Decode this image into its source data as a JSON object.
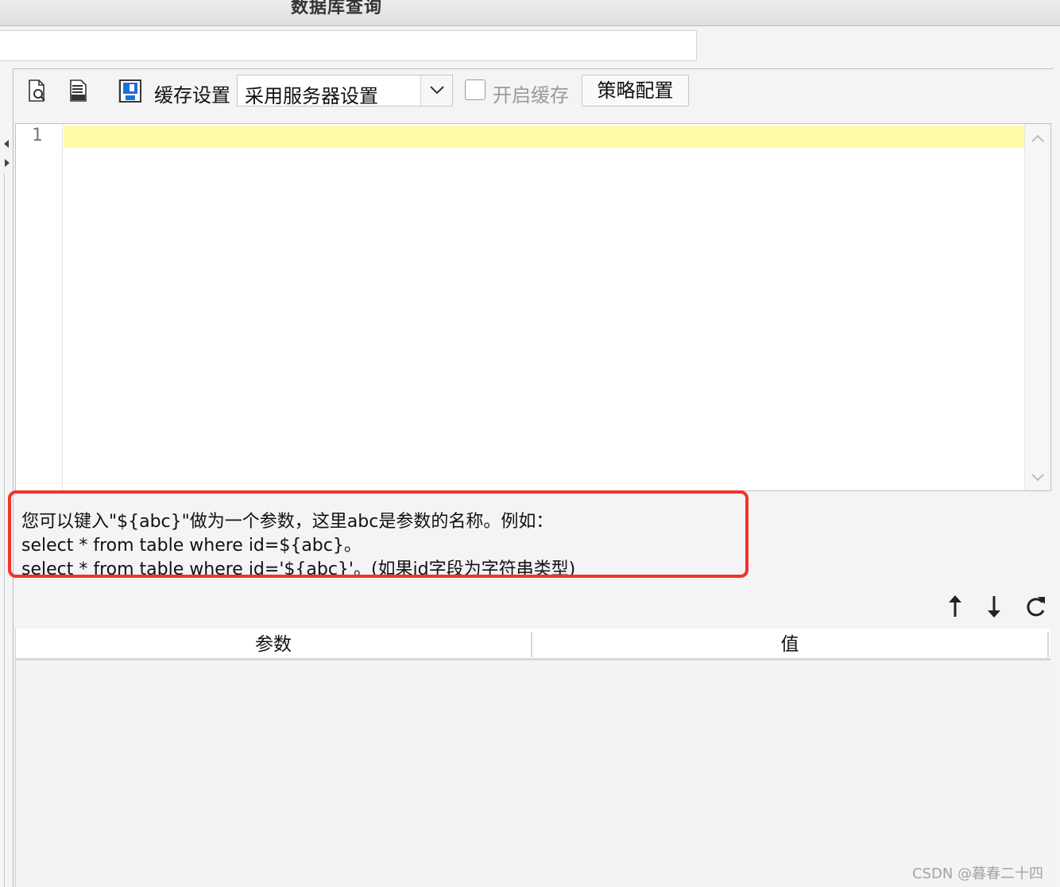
{
  "window": {
    "title": "数据库查询"
  },
  "toolbar": {
    "cache_label": "缓存设置",
    "cache_mode_value": "采用服务器设置",
    "enable_cache_label": "开启缓存",
    "enable_cache_checked": false,
    "strategy_button": "策略配置"
  },
  "editor": {
    "line_numbers": [
      "1"
    ],
    "content": ""
  },
  "hint": {
    "line1": "您可以键入\"${abc}\"做为一个参数，这里abc是参数的名称。例如：",
    "line2": "select * from table where id=${abc}。",
    "line3": "select * from table where id='${abc}'。(如果id字段为字符串类型)"
  },
  "param_table": {
    "columns": [
      "参数",
      "值"
    ],
    "rows": []
  },
  "watermark": "CSDN @暮春二十四"
}
